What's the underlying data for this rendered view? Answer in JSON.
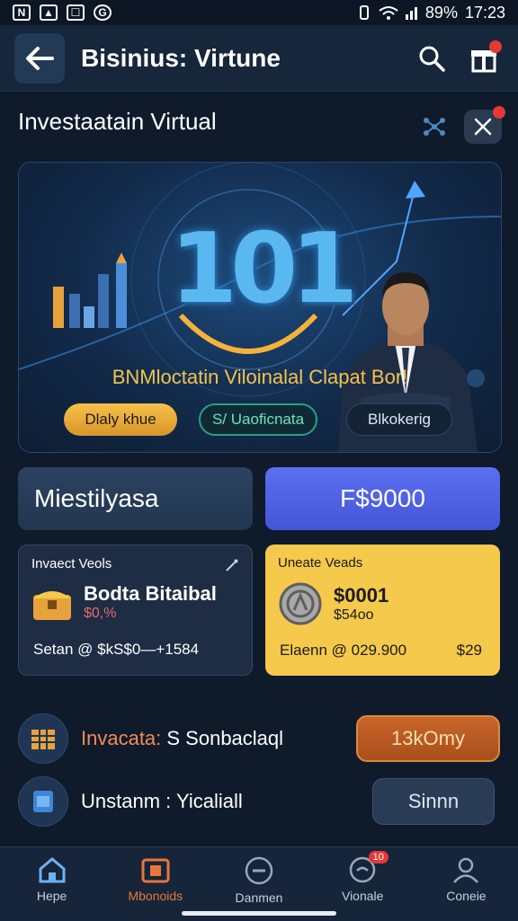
{
  "status_bar": {
    "left_badges": [
      "N",
      "▲",
      "☐",
      "G"
    ],
    "battery": "89%",
    "time": "17:23"
  },
  "app_bar": {
    "title": "Bisinius: Virtune"
  },
  "section": {
    "title": "Investaatain Virtual"
  },
  "hero": {
    "number": "101",
    "caption": "BNMloctatin Viloinalal Clapat Bor!",
    "pills": [
      "Dlaly khue",
      "S/ Uaoficnata",
      "Blkokerig"
    ]
  },
  "buttons": {
    "left": "Miestilyasa",
    "right": "F$9000"
  },
  "cards": {
    "left": {
      "label": "Invaect Veols",
      "title": "Bodta Bitaibal",
      "sub": "$0,%",
      "footer": "Setan @ $kS$0—+1584"
    },
    "right": {
      "label": "Uneate Veads",
      "title": "$0001",
      "sub": "$54oo",
      "footer": "Elaenn @ 029.900",
      "footer_right": "$29"
    }
  },
  "rows": [
    {
      "label_prefix": "Invacata:",
      "label_rest": " S Sonbaclaql",
      "button": "13kOmy"
    },
    {
      "label_prefix": "Unstanm :",
      "label_rest": " Yicaliall",
      "button": "Sinnn"
    }
  ],
  "bottom_nav": {
    "items": [
      {
        "label": "Hepe",
        "icon": "home-icon"
      },
      {
        "label": "Mbonoids",
        "icon": "wallet-icon"
      },
      {
        "label": "Danmen",
        "icon": "minus-circle-icon"
      },
      {
        "label": "Vionale",
        "icon": "chat-icon",
        "badge": "10"
      },
      {
        "label": "Coneie",
        "icon": "profile-icon"
      }
    ]
  },
  "colors": {
    "accent_orange": "#e8763a",
    "gold": "#f5c94b",
    "blue": "#4f63e6"
  }
}
